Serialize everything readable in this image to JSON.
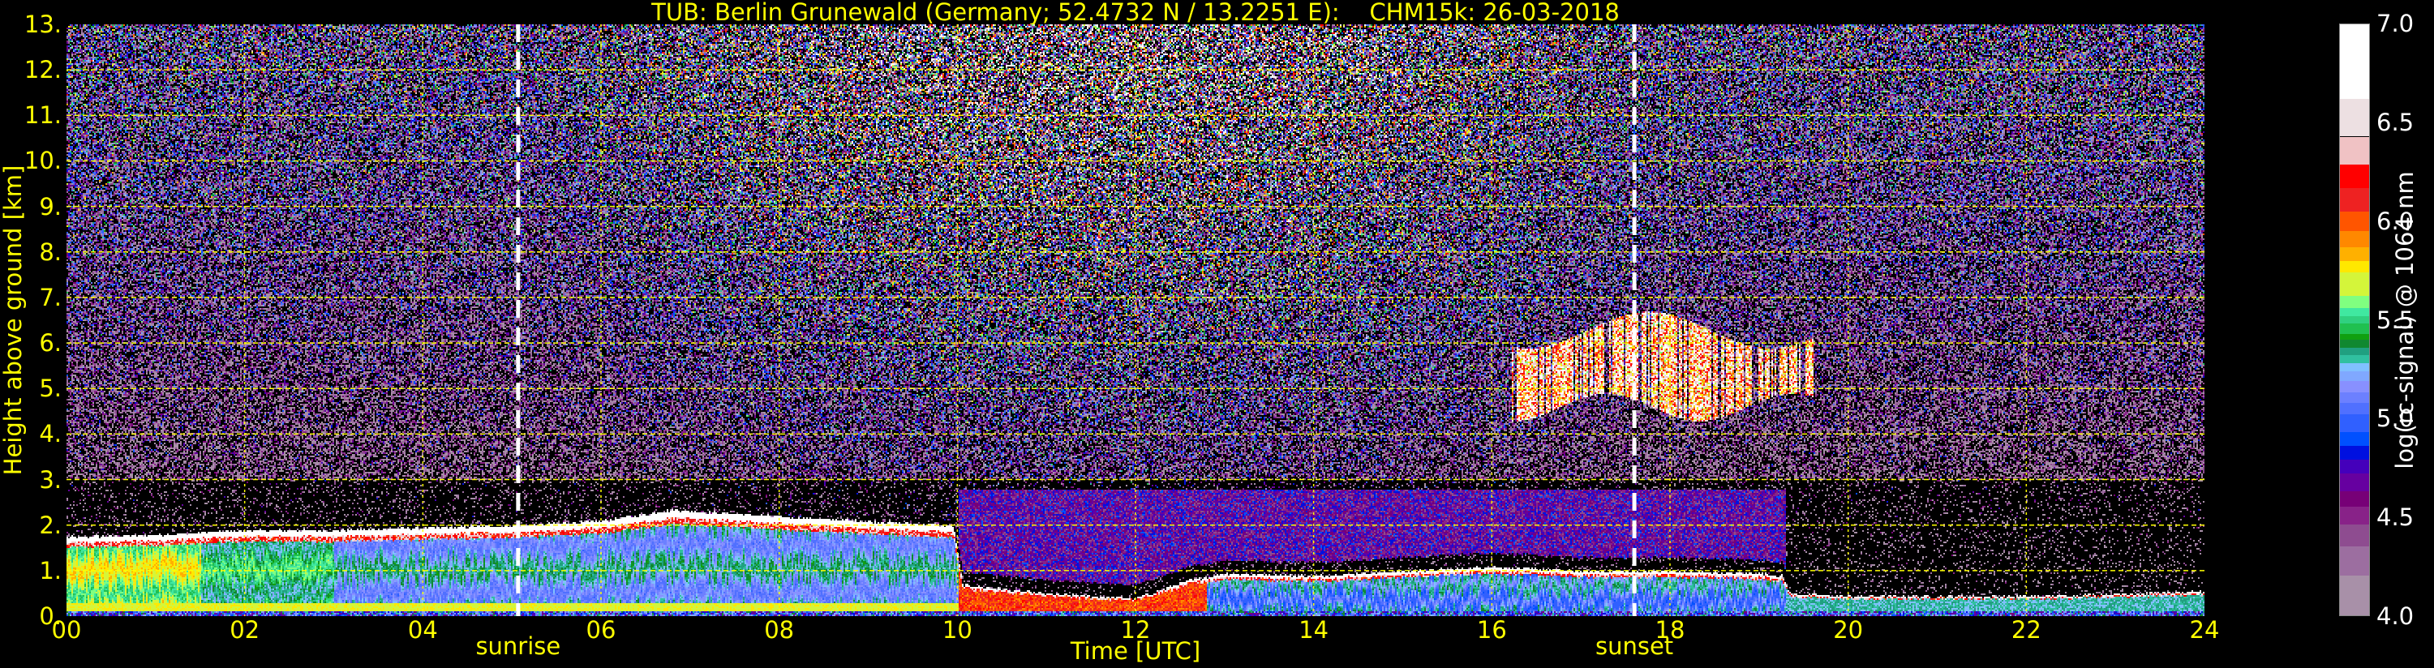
{
  "chart_data": {
    "type": "heatmap",
    "title": "TUB: Berlin Grunewald (Germany; 52.4732 N / 13.2251 E):    CHM15k: 26-03-2018",
    "xlabel": "Time [UTC]",
    "ylabel": "Height above ground [km]",
    "xlim": [
      0,
      24
    ],
    "ylim": [
      0,
      13
    ],
    "x_ticks": [
      "00",
      "02",
      "04",
      "06",
      "08",
      "10",
      "12",
      "14",
      "16",
      "18",
      "20",
      "22",
      "24"
    ],
    "y_ticks": [
      "0.",
      "1.",
      "2.",
      "3.",
      "4.",
      "5.",
      "6.",
      "7.",
      "8.",
      "9.",
      "10.",
      "11.",
      "12.",
      "13."
    ],
    "grid": true,
    "grid_color": "#ffff00",
    "annotations": [
      {
        "label": "sunrise",
        "time_h": 5.07
      },
      {
        "label": "sunset",
        "time_h": 17.6
      }
    ],
    "colorbar": {
      "label": "log(rc-signal) @ 1064 nm",
      "range": [
        4.0,
        7.0
      ],
      "ticks": [
        "4.0",
        "4.5",
        "5.0",
        "5.5",
        "6.0",
        "6.5",
        "7.0"
      ],
      "below_range_color": "#000000",
      "levels": [
        {
          "min": 6.62,
          "color": "#ffffff"
        },
        {
          "min": 6.43,
          "color": "#ede0e2"
        },
        {
          "min": 6.29,
          "color": "#f0c2c4"
        },
        {
          "min": 6.17,
          "color": "#ff0000"
        },
        {
          "min": 6.05,
          "color": "#ee2222"
        },
        {
          "min": 5.95,
          "color": "#ff5500"
        },
        {
          "min": 5.87,
          "color": "#ff8800"
        },
        {
          "min": 5.8,
          "color": "#ffb000"
        },
        {
          "min": 5.74,
          "color": "#ffe800"
        },
        {
          "min": 5.62,
          "color": "#d4f53a"
        },
        {
          "min": 5.56,
          "color": "#80ff80"
        },
        {
          "min": 5.52,
          "color": "#40e8a0"
        },
        {
          "min": 5.48,
          "color": "#30d080"
        },
        {
          "min": 5.43,
          "color": "#20c050"
        },
        {
          "min": 5.4,
          "color": "#10a010"
        },
        {
          "min": 5.36,
          "color": "#108830"
        },
        {
          "min": 5.32,
          "color": "#20a080"
        },
        {
          "min": 5.28,
          "color": "#30c0a0"
        },
        {
          "min": 5.24,
          "color": "#80c0ff"
        },
        {
          "min": 5.19,
          "color": "#80a8ff"
        },
        {
          "min": 5.13,
          "color": "#8890ff"
        },
        {
          "min": 5.08,
          "color": "#6c80ff"
        },
        {
          "min": 5.02,
          "color": "#5070ff"
        },
        {
          "min": 4.93,
          "color": "#3060ff"
        },
        {
          "min": 4.86,
          "color": "#0050ff"
        },
        {
          "min": 4.79,
          "color": "#0010e0"
        },
        {
          "min": 4.72,
          "color": "#4400bb"
        },
        {
          "min": 4.63,
          "color": "#6600a0"
        },
        {
          "min": 4.55,
          "color": "#770077"
        },
        {
          "min": 4.46,
          "color": "#882288"
        },
        {
          "min": 4.35,
          "color": "#8e4c90"
        },
        {
          "min": 4.2,
          "color": "#9c6ea0"
        },
        {
          "min": 4.0,
          "color": "#a890a8"
        }
      ]
    },
    "aerosol_layer_top_km": {
      "time_h": [
        0,
        1,
        2,
        3,
        4,
        5,
        6,
        6.8,
        8,
        9,
        9.95,
        10.05,
        11,
        12,
        12.6,
        13,
        14,
        15,
        16,
        17,
        18,
        19,
        19.25,
        19.35,
        20,
        22,
        24
      ],
      "height_km": [
        1.75,
        1.8,
        1.9,
        1.9,
        1.95,
        2.0,
        2.1,
        2.35,
        2.2,
        2.1,
        2.0,
        0.7,
        0.5,
        0.4,
        0.8,
        0.95,
        0.9,
        1.0,
        1.1,
        1.0,
        1.0,
        0.95,
        0.9,
        0.5,
        0.45,
        0.45,
        0.55
      ]
    },
    "cloud_layer": {
      "time_h": [
        16.2,
        19.6
      ],
      "base_km": 4.6,
      "top_km": 6.3
    }
  }
}
